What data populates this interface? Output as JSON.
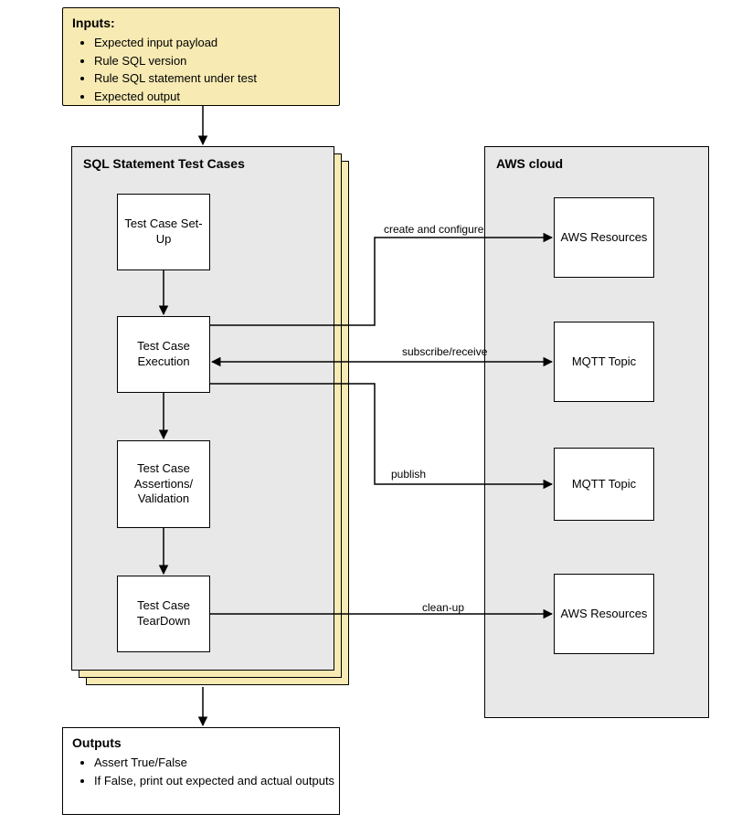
{
  "inputs": {
    "title": "Inputs",
    "items": [
      "Expected input payload",
      "Rule SQL version",
      "Rule SQL statement under test",
      "Expected output"
    ]
  },
  "test_cases": {
    "title": "SQL Statement Test Cases",
    "steps": {
      "setup": "Test Case Set-Up",
      "execution": "Test Case Execution",
      "assertions": "Test Case Assertions/ Validation",
      "teardown": "Test Case TearDown"
    }
  },
  "aws": {
    "title": "AWS cloud",
    "nodes": {
      "resources1": "AWS Resources",
      "mqtt1": "MQTT Topic",
      "mqtt2": "MQTT Topic",
      "resources2": "AWS Resources"
    }
  },
  "edges": {
    "create_configure": "create and configure",
    "subscribe_receive": "subscribe/receive",
    "publish": "publish",
    "cleanup": "clean-up"
  },
  "outputs": {
    "title": "Outputs",
    "items": [
      "Assert True/False",
      "If False, print out expected and actual outputs"
    ]
  }
}
